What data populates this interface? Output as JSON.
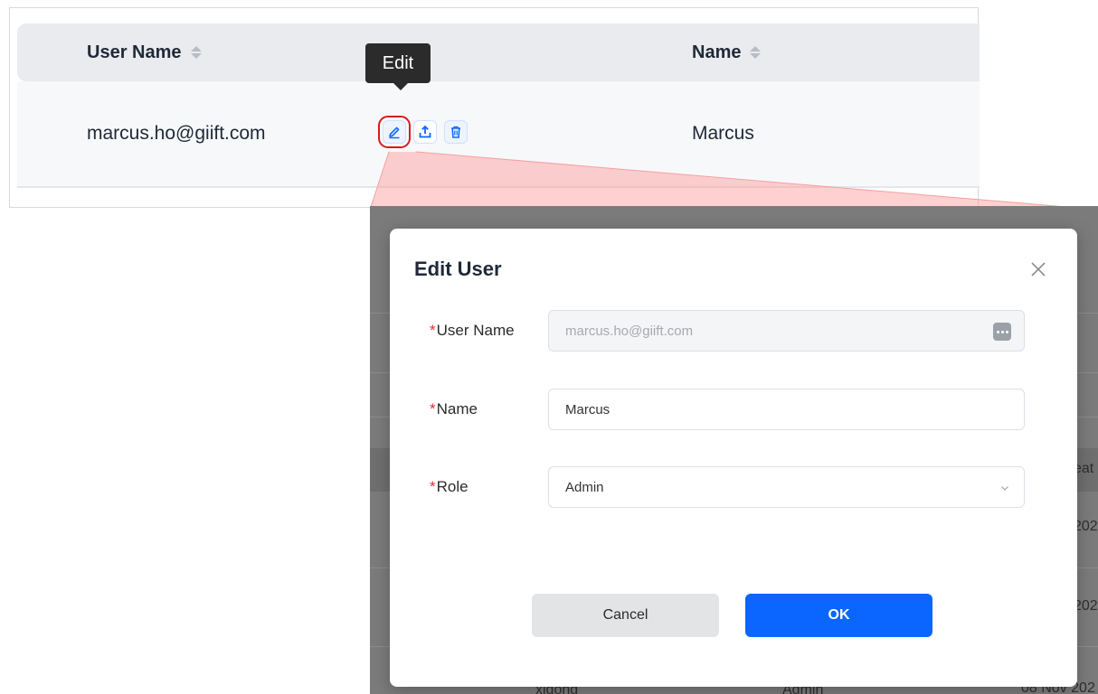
{
  "table": {
    "headers": {
      "user_name": "User Name",
      "name": "Name"
    },
    "row": {
      "user_name": "marcus.ho@giift.com",
      "name": "Marcus"
    },
    "tooltip": "Edit"
  },
  "background": {
    "partial_col_header": "eat",
    "partial_dates": [
      "202",
      "202",
      "08 Nov 202"
    ],
    "partial_bottom": [
      "xidong",
      "Admin"
    ]
  },
  "modal": {
    "title": "Edit User",
    "fields": [
      {
        "label": "User Name",
        "required_mark": "*",
        "value": "marcus.ho@giift.com"
      },
      {
        "label": "Name",
        "required_mark": "*",
        "value": "Marcus"
      },
      {
        "label": "Role",
        "required_mark": "*",
        "value": "Admin"
      }
    ],
    "cancel_label": "Cancel",
    "ok_label": "OK"
  },
  "colors": {
    "primary": "#0a66ff",
    "highlight_red": "#d91c1c",
    "required": "#e0312f"
  }
}
